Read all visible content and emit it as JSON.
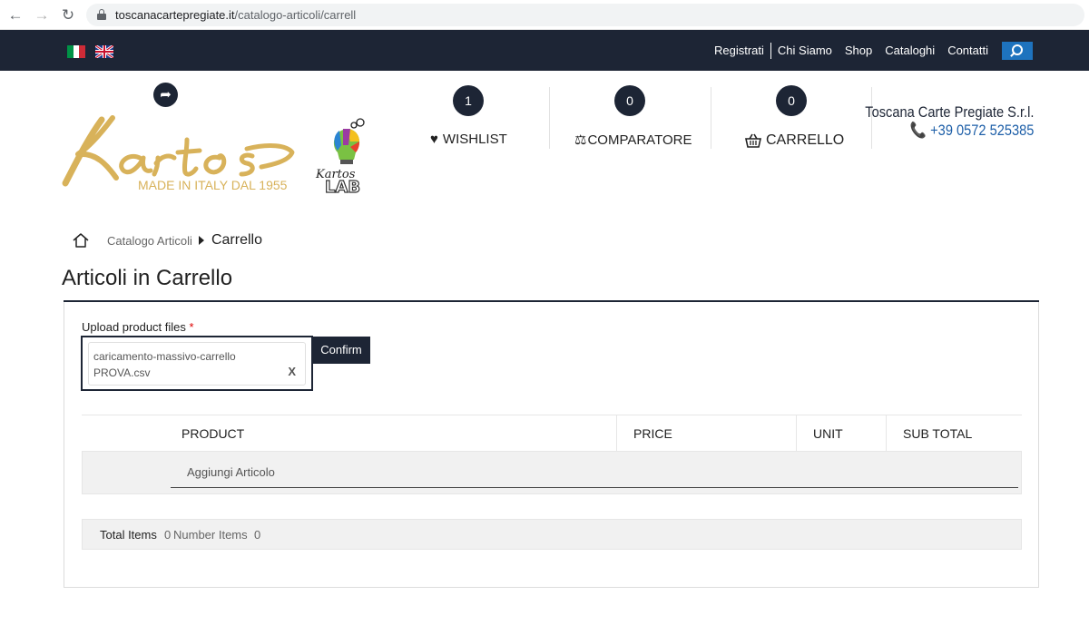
{
  "browser": {
    "url_host": "toscanacartepregiate.it",
    "url_path": "/catalogo-articoli/carrell"
  },
  "topnav": {
    "links": [
      "Registrati",
      "Chi Siamo",
      "Shop",
      "Cataloghi",
      "Contatti"
    ]
  },
  "logo": {
    "tagline": "MADE IN ITALY DAL 1955"
  },
  "header": {
    "wishlist": {
      "count": "1",
      "label": "WISHLIST"
    },
    "compare": {
      "count": "0",
      "label": "COMPARATORE"
    },
    "cart": {
      "count": "0",
      "label": "CARRELLO"
    },
    "company_name": "Toscana Carte Pregiate S.r.l.",
    "company_phone": "+39 0572 525385"
  },
  "breadcrumb": {
    "parent": "Catalogo Articoli",
    "current": "Carrello"
  },
  "page": {
    "title": "Articoli in Carrello"
  },
  "upload": {
    "label": "Upload product files",
    "required_mark": "*",
    "file_name_line1": "caricamento-massivo-carrello",
    "file_name_line2": "PROVA.csv",
    "remove_label": "X",
    "confirm_label": "Confirm"
  },
  "table": {
    "headers": [
      "PRODUCT",
      "PRICE",
      "UNIT",
      "SUB TOTAL"
    ],
    "add_item_label": "Aggiungi Articolo"
  },
  "totals": {
    "total_items_label": "Total Items",
    "total_items_value": "0",
    "number_items_label": "Number Items",
    "number_items_value": "0"
  },
  "colors": {
    "navy": "#1d2535",
    "gold": "#d8b25a",
    "blue": "#1e73be"
  }
}
